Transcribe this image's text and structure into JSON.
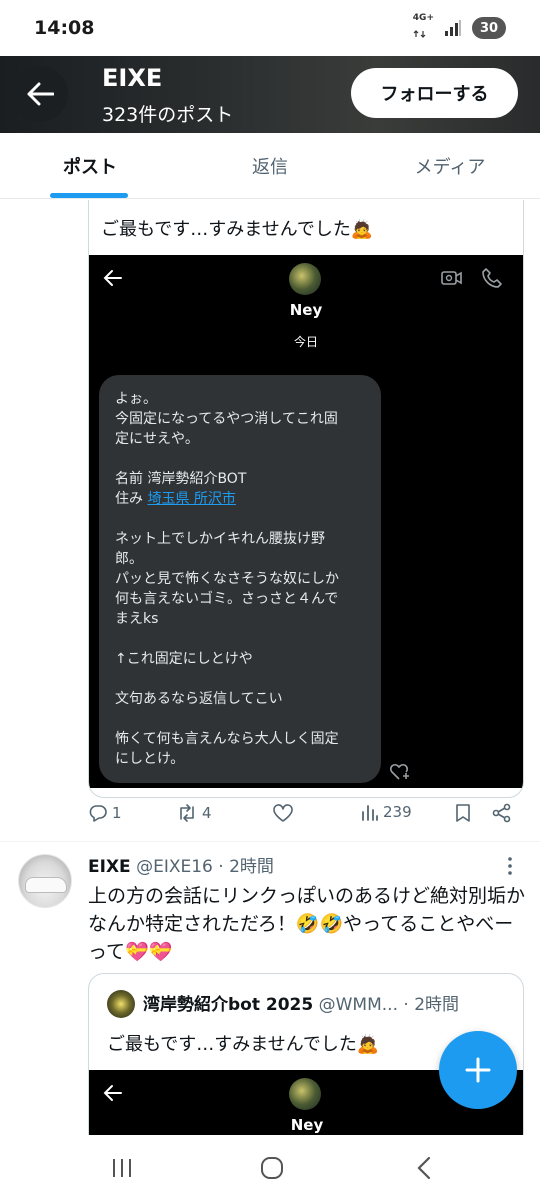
{
  "status_bar": {
    "time": "14:08",
    "network": "4G+",
    "battery": "30"
  },
  "header": {
    "title": "EIXE",
    "subtitle": "323件のポスト",
    "follow_label": "フォローする"
  },
  "tabs": [
    {
      "label": "ポスト",
      "active": true
    },
    {
      "label": "返信",
      "active": false
    },
    {
      "label": "メディア",
      "active": false
    }
  ],
  "tweet1": {
    "quote_text": "ご最もです…すみませんでした🙇",
    "dm": {
      "name": "Ney",
      "day": "今日",
      "lines": {
        "l1": "よぉ。",
        "l2": "今固定になってるやつ消してこれ固",
        "l3": "定にせえや。",
        "l4_prefix": "名前 ",
        "l4_value": "湾岸勢紹介BOT",
        "l5_prefix": "住み ",
        "l5_link": "埼玉県 所沢市",
        "l6": "ネット上でしかイキれん腰抜け野",
        "l7": "郎。",
        "l8": "パッと見で怖くなさそうな奴にしか",
        "l9": "何も言えないゴミ。さっさと４んで",
        "l10": "まえks",
        "l11": "↑これ固定にしとけや",
        "l12": "文句あるなら返信してこい",
        "l13": "怖くて何も言えんなら大人しく固定",
        "l14": "にしとけ。"
      }
    },
    "actions": {
      "replies": "1",
      "reposts": "4",
      "likes": "",
      "views": "239"
    }
  },
  "tweet2": {
    "name": "EIXE",
    "handle": "@EIXE16",
    "time": "· 2時間",
    "text": "上の方の会話にリンクっぽいのあるけど絶対別垢かなんか特定されただろ！🤣🤣やってることやべーって💝💝",
    "quote": {
      "name": "湾岸勢紹介bot 2025",
      "handle": "@WMM...",
      "time": "· 2時間",
      "text": "ご最もです…すみませんでした🙇",
      "dm_name": "Ney"
    }
  },
  "colors": {
    "accent": "#1d9bf0",
    "text": "#0f1419",
    "muted": "#536471"
  },
  "icons": [
    "back-arrow-icon",
    "reply-icon",
    "repost-icon",
    "like-icon",
    "views-icon",
    "bookmark-icon",
    "share-icon",
    "more-icon",
    "plus-icon",
    "video-call-icon",
    "phone-icon",
    "add-reaction-icon"
  ]
}
